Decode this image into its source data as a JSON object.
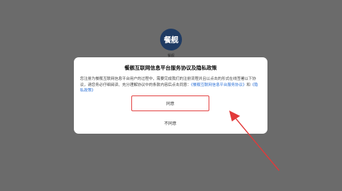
{
  "app": {
    "logo_text": "餐舰",
    "logo_caption": "餐舰"
  },
  "dialog": {
    "title": "餐舰互联网信息平台服务协议及隐私政策",
    "body_text": "您注册为餐舰互联网信息平台用户的过程中，需要完成我们的注册流程并且以点击的形式在线签署以下协议，请您务必仔细阅读、充分理解协议中的条款内容后点击同意：",
    "service_link": "《餐舰互联网信息平台服务协议》",
    "connector": "和",
    "privacy_link": "《隐私政策》",
    "agree_label": "同意",
    "disagree_label": "不同意"
  },
  "colors": {
    "overlay": "#6b6b6b",
    "highlight": "#e23a3a",
    "link": "#2a6fd6",
    "logo_bg": "#1f3b63"
  }
}
